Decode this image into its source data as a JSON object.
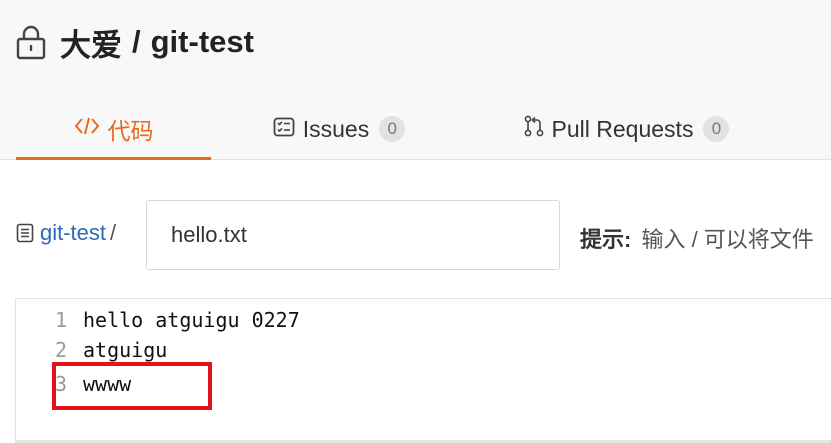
{
  "repo": {
    "owner": "大爱",
    "separator": "/",
    "name": "git-test"
  },
  "tabs": [
    {
      "icon": "code-icon",
      "label": "代码",
      "active": true
    },
    {
      "icon": "issues-icon",
      "label": "Issues",
      "count": "0"
    },
    {
      "icon": "pull-request-icon",
      "label": "Pull Requests",
      "count": "0"
    }
  ],
  "path": {
    "repo_link": "git-test",
    "separator": "/",
    "filename_value": "hello.txt",
    "hint_label": "提示:",
    "hint_text": "输入 / 可以将文件"
  },
  "editor": {
    "lines": [
      {
        "number": "1",
        "text": "hello atguigu 0227"
      },
      {
        "number": "2",
        "text": "atguigu"
      },
      {
        "number": "3",
        "text": "wwww"
      }
    ]
  },
  "colors": {
    "accent": "#e86b1c",
    "link": "#2c6bb7",
    "annotation": "#e0151b"
  }
}
